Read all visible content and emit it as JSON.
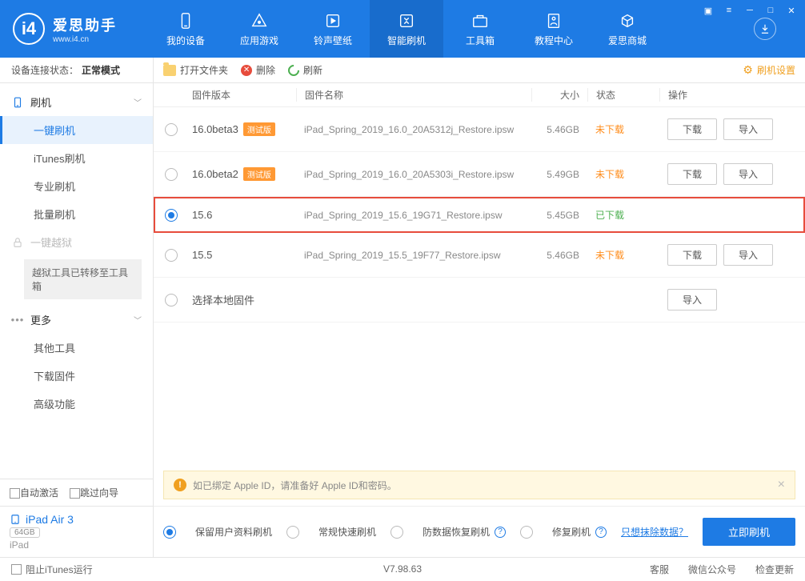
{
  "app": {
    "title": "爱思助手",
    "subtitle": "www.i4.cn"
  },
  "nav": [
    {
      "label": "我的设备"
    },
    {
      "label": "应用游戏"
    },
    {
      "label": "铃声壁纸"
    },
    {
      "label": "智能刷机"
    },
    {
      "label": "工具箱"
    },
    {
      "label": "教程中心"
    },
    {
      "label": "爱思商城"
    }
  ],
  "sidebar": {
    "conn_prefix": "设备连接状态：",
    "conn_status": "正常模式",
    "flash_group": "刷机",
    "flash_items": [
      "一键刷机",
      "iTunes刷机",
      "专业刷机",
      "批量刷机"
    ],
    "jailbreak_group": "一键越狱",
    "jailbreak_note": "越狱工具已转移至工具箱",
    "more_group": "更多",
    "more_items": [
      "其他工具",
      "下载固件",
      "高级功能"
    ],
    "auto_activate": "自动激活",
    "skip_guide": "跳过向导",
    "device": {
      "name": "iPad Air 3",
      "storage": "64GB",
      "type": "iPad"
    }
  },
  "toolbar": {
    "open": "打开文件夹",
    "delete": "删除",
    "refresh": "刷新",
    "settings": "刷机设置"
  },
  "columns": {
    "version": "固件版本",
    "name": "固件名称",
    "size": "大小",
    "status": "状态",
    "action": "操作"
  },
  "firmware": [
    {
      "selected": false,
      "version": "16.0beta3",
      "beta": "测试版",
      "name": "iPad_Spring_2019_16.0_20A5312j_Restore.ipsw",
      "size": "5.46GB",
      "status": "未下载",
      "status_class": "status-orange",
      "download": "下载",
      "import": "导入"
    },
    {
      "selected": false,
      "version": "16.0beta2",
      "beta": "测试版",
      "name": "iPad_Spring_2019_16.0_20A5303i_Restore.ipsw",
      "size": "5.49GB",
      "status": "未下载",
      "status_class": "status-orange",
      "download": "下载",
      "import": "导入"
    },
    {
      "selected": true,
      "highlighted": true,
      "version": "15.6",
      "name": "iPad_Spring_2019_15.6_19G71_Restore.ipsw",
      "size": "5.45GB",
      "status": "已下载",
      "status_class": "status-green"
    },
    {
      "selected": false,
      "version": "15.5",
      "name": "iPad_Spring_2019_15.5_19F77_Restore.ipsw",
      "size": "5.46GB",
      "status": "未下载",
      "status_class": "status-orange",
      "download": "下载",
      "import": "导入"
    },
    {
      "selected": false,
      "version": "选择本地固件",
      "import": "导入"
    }
  ],
  "alert": "如已绑定 Apple ID，请准备好 Apple ID和密码。",
  "options": {
    "opt1": "保留用户资料刷机",
    "opt2": "常规快速刷机",
    "opt3": "防数据恢复刷机",
    "opt4": "修复刷机",
    "link": "只想抹除数据？",
    "flash": "立即刷机"
  },
  "footer": {
    "block_itunes": "阻止iTunes运行",
    "version": "V7.98.63",
    "service": "客服",
    "wechat": "微信公众号",
    "update": "检查更新"
  }
}
